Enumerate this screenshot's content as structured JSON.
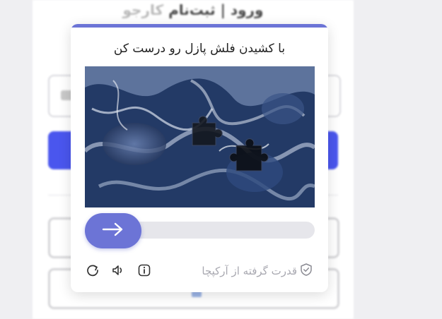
{
  "background_page": {
    "title_main": "ورود | ثبت‌نام",
    "title_brand": "کارجو"
  },
  "captcha": {
    "title": "با کشیدن فلش پازل رو درست کن",
    "slider_progress": 0,
    "powered_by": "قدرت گرفته از آرکپچا",
    "icons": {
      "refresh": "refresh-icon",
      "audio": "speaker-icon",
      "info": "info-icon",
      "shield": "shield-check-icon",
      "arrow": "arrow-right-icon"
    },
    "colors": {
      "accent": "#6c74d6",
      "track": "#e6e6eb",
      "button_blue": "#4a56ee"
    }
  }
}
